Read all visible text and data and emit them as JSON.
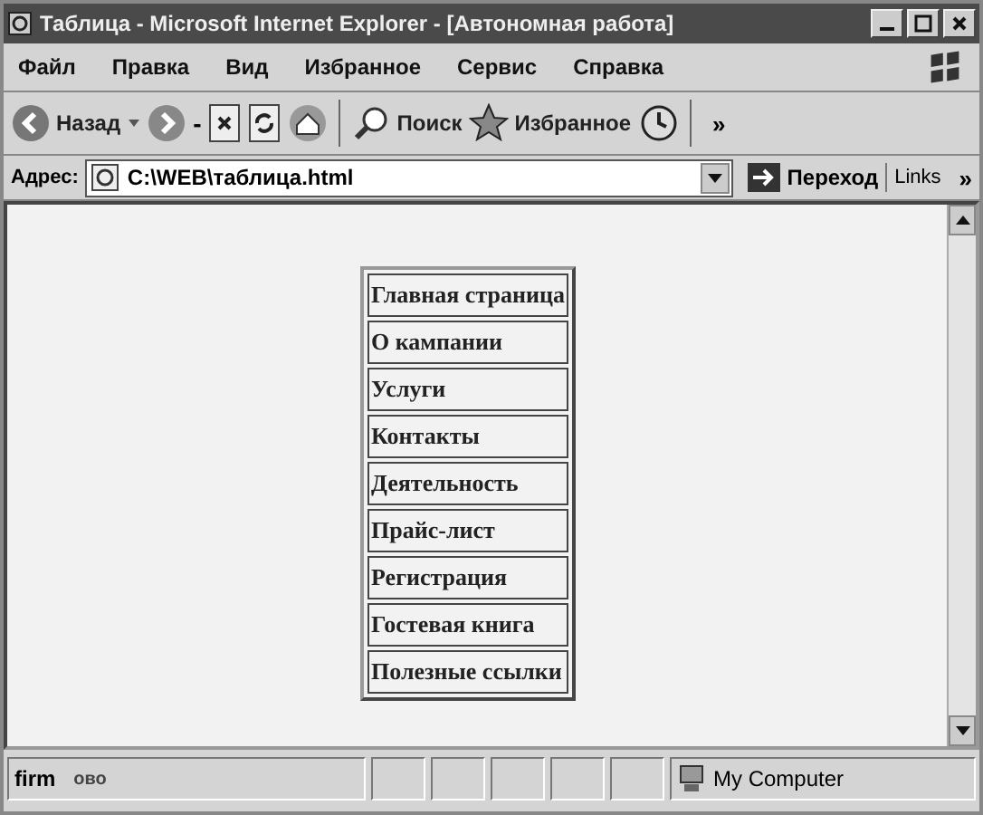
{
  "window": {
    "title": "Таблица - Microsoft Internet Explorer - [Автономная работа]"
  },
  "menu": [
    "Файл",
    "Правка",
    "Вид",
    "Избранное",
    "Сервис",
    "Справка"
  ],
  "toolbar": [
    {
      "kind": "back",
      "label": "Назад"
    },
    {
      "kind": "forward"
    },
    {
      "kind": "dash",
      "label": "-"
    },
    {
      "kind": "stop"
    },
    {
      "kind": "refresh"
    },
    {
      "kind": "home"
    },
    {
      "kind": "sep"
    },
    {
      "kind": "search",
      "label": "Поиск"
    },
    {
      "kind": "favorites",
      "label": "Избранное"
    },
    {
      "kind": "history"
    },
    {
      "kind": "sep"
    },
    {
      "kind": "more",
      "label": "»"
    }
  ],
  "address": {
    "label": "Адрес:",
    "value": "C:\\WEB\\таблица.html",
    "go": "Переход",
    "links": "Links",
    "more": "»"
  },
  "table": {
    "rows": [
      "Главная страница",
      "О кампании",
      "Услуги",
      "Контакты",
      "Деятельность",
      "Прайс-лист",
      "Регистрация",
      "Гостевая книга",
      "Полезные ссылки"
    ]
  },
  "status_bar": {
    "texts": [
      "firm",
      "ово"
    ],
    "zone": "My Computer"
  }
}
